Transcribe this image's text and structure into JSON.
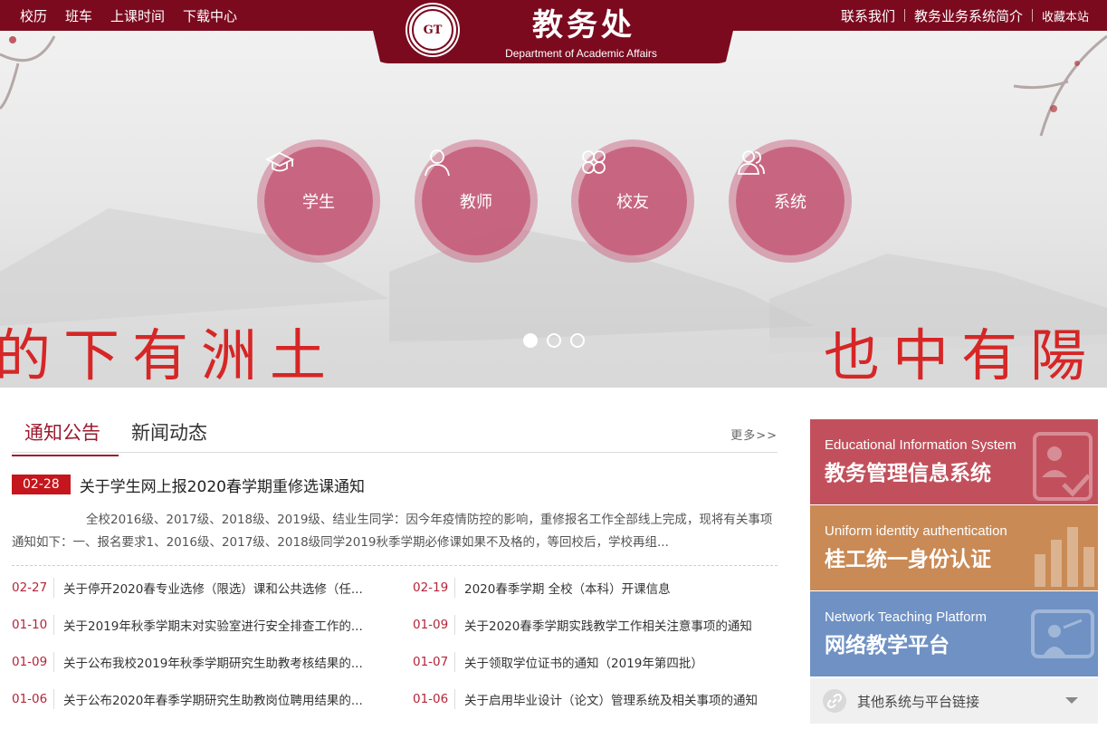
{
  "topnav": {
    "left": [
      "校历",
      "班车",
      "上课时间",
      "下载中心"
    ],
    "right": [
      "联系我们",
      "教务业务系统简介",
      "收藏本站"
    ]
  },
  "brand": {
    "title": "教务处",
    "subtitle": "Department of Academic Affairs"
  },
  "quick_links": [
    {
      "label": "学生",
      "icon": "graduation-cap-icon"
    },
    {
      "label": "教师",
      "icon": "person-icon"
    },
    {
      "label": "校友",
      "icon": "clover-icon"
    },
    {
      "label": "系统",
      "icon": "users-icon"
    }
  ],
  "slider": {
    "active_index": 0,
    "count": 3
  },
  "news": {
    "tabs": [
      "通知公告",
      "新闻动态"
    ],
    "more": "更多>>",
    "featured": {
      "date": "02-28",
      "title": "关于学生网上报2020春学期重修选课通知",
      "summary": "全校2016级、2017级、2018级、2019级、结业生同学：因今年疫情防控的影响，重修报名工作全部线上完成，现将有关事项通知如下：一、报名要求1、2016级、2017级、2018级同学2019秋季学期必修课如果不及格的，等回校后，学校再组..."
    },
    "items": [
      {
        "date": "02-27",
        "title": "关于停开2020春专业选修（限选）课和公共选修（任..."
      },
      {
        "date": "02-19",
        "title": "2020春季学期 全校（本科）开课信息"
      },
      {
        "date": "01-10",
        "title": "关于2019年秋季学期末对实验室进行安全排查工作的..."
      },
      {
        "date": "01-09",
        "title": "关于2020春季学期实践教学工作相关注意事项的通知"
      },
      {
        "date": "01-09",
        "title": "关于公布我校2019年秋季学期研究生助教考核结果的..."
      },
      {
        "date": "01-07",
        "title": "关于领取学位证书的通知（2019年第四批）"
      },
      {
        "date": "01-06",
        "title": "关于公布2020年春季学期研究生助教岗位聘用结果的..."
      },
      {
        "date": "01-06",
        "title": "关于启用毕业设计（论文）管理系统及相关事项的通知"
      }
    ]
  },
  "panels": [
    {
      "en": "Educational Information System",
      "cn": "教务管理信息系统",
      "color": "#c2505c"
    },
    {
      "en": "Uniform identity authentication",
      "cn": "桂工统一身份认证",
      "color": "#c98a55"
    },
    {
      "en": "Network Teaching Platform",
      "cn": "网络教学平台",
      "color": "#6f91c4"
    }
  ],
  "other_links": {
    "label": "其他系统与平台链接"
  }
}
